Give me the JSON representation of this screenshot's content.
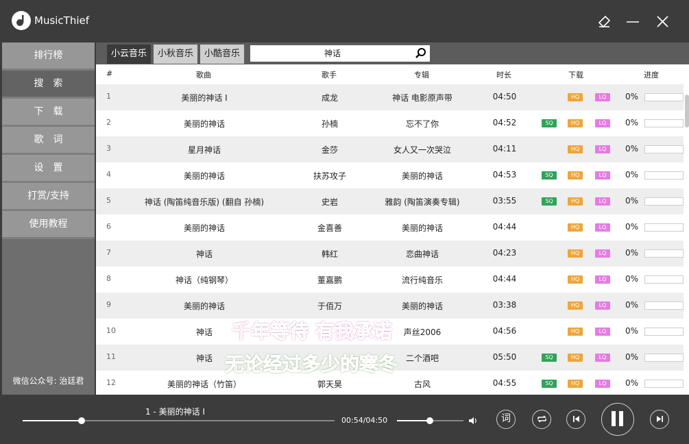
{
  "app": {
    "title": "MusicThief"
  },
  "sidebar": {
    "items": [
      {
        "label": "排行榜"
      },
      {
        "label": "搜　索"
      },
      {
        "label": "下　载"
      },
      {
        "label": "歌　词"
      },
      {
        "label": "设　置"
      },
      {
        "label": "打赏/支持"
      },
      {
        "label": "使用教程"
      }
    ],
    "footer": "微信公众号: 治廷君"
  },
  "tabs": [
    {
      "label": "小云音乐",
      "state": "active"
    },
    {
      "label": "小秋音乐",
      "state": "inactive"
    },
    {
      "label": "小酷音乐",
      "state": "inactive"
    }
  ],
  "search": {
    "value": "神话"
  },
  "table": {
    "headers": {
      "num": "#",
      "song": "歌曲",
      "artist": "歌手",
      "album": "专辑",
      "duration": "时长",
      "download": "下载",
      "progress": "进度"
    },
    "rows": [
      {
        "num": "1",
        "song": "美丽的神话 I",
        "artist": "成龙",
        "album": "神话 电影原声带",
        "duration": "04:50",
        "sq": "",
        "hq": "HQ",
        "lq": "LQ",
        "progress": "0%"
      },
      {
        "num": "2",
        "song": "美丽的神话",
        "artist": "孙楠",
        "album": "忘不了你",
        "duration": "04:52",
        "sq": "SQ",
        "hq": "HQ",
        "lq": "LQ",
        "progress": "0%"
      },
      {
        "num": "3",
        "song": "星月神话",
        "artist": "金莎",
        "album": "女人又一次哭泣",
        "duration": "04:11",
        "sq": "",
        "hq": "HQ",
        "lq": "LQ",
        "progress": "0%"
      },
      {
        "num": "4",
        "song": "美丽的神话",
        "artist": "扶苏攻子",
        "album": "美丽的神话",
        "duration": "04:53",
        "sq": "SQ",
        "hq": "HQ",
        "lq": "LQ",
        "progress": "0%"
      },
      {
        "num": "5",
        "song": "神话 (陶笛纯音乐版) (翻自 孙楠)",
        "artist": "史岩",
        "album": "雅韵 (陶笛演奏专辑)",
        "duration": "03:55",
        "sq": "SQ",
        "hq": "HQ",
        "lq": "LQ",
        "progress": "0%"
      },
      {
        "num": "6",
        "song": "美丽的神话",
        "artist": "金喜善",
        "album": "美丽的神话",
        "duration": "04:44",
        "sq": "",
        "hq": "HQ",
        "lq": "LQ",
        "progress": "0%"
      },
      {
        "num": "7",
        "song": "神话",
        "artist": "韩红",
        "album": "恋曲神话",
        "duration": "04:23",
        "sq": "",
        "hq": "HQ",
        "lq": "LQ",
        "progress": "0%"
      },
      {
        "num": "8",
        "song": "神话（纯钢琴）",
        "artist": "董嘉鹏",
        "album": "流行纯音乐",
        "duration": "04:44",
        "sq": "",
        "hq": "HQ",
        "lq": "LQ",
        "progress": "0%"
      },
      {
        "num": "9",
        "song": "美丽的神话",
        "artist": "于佰万",
        "album": "美丽的神话",
        "duration": "03:38",
        "sq": "",
        "hq": "HQ",
        "lq": "LQ",
        "progress": "0%"
      },
      {
        "num": "10",
        "song": "神话",
        "artist": "",
        "album": "声丝2006",
        "duration": "04:56",
        "sq": "",
        "hq": "HQ",
        "lq": "LQ",
        "progress": "0%"
      },
      {
        "num": "11",
        "song": "神话",
        "artist": "",
        "album": "二个酒吧",
        "duration": "05:50",
        "sq": "SQ",
        "hq": "HQ",
        "lq": "LQ",
        "progress": "0%"
      },
      {
        "num": "12",
        "song": "美丽的神话（竹笛）",
        "artist": "郭天昊",
        "album": "古风",
        "duration": "04:55",
        "sq": "SQ",
        "hq": "HQ",
        "lq": "LQ",
        "progress": "0%"
      }
    ]
  },
  "lyrics": {
    "line1": "千年等待 有我承诺",
    "line2": "无论经过多少的寒冬"
  },
  "player": {
    "track": "1 - 美丽的神话 I",
    "time": "00:54/04:50",
    "position": 0.19,
    "volume": 0.49,
    "lyrics_button": "词"
  },
  "colors": {
    "sq": "#31a35a",
    "hq": "#f0a53a",
    "lq": "#e57ce3",
    "lyric1": "#e24ab8",
    "lyric2": "#6fbf3b"
  }
}
